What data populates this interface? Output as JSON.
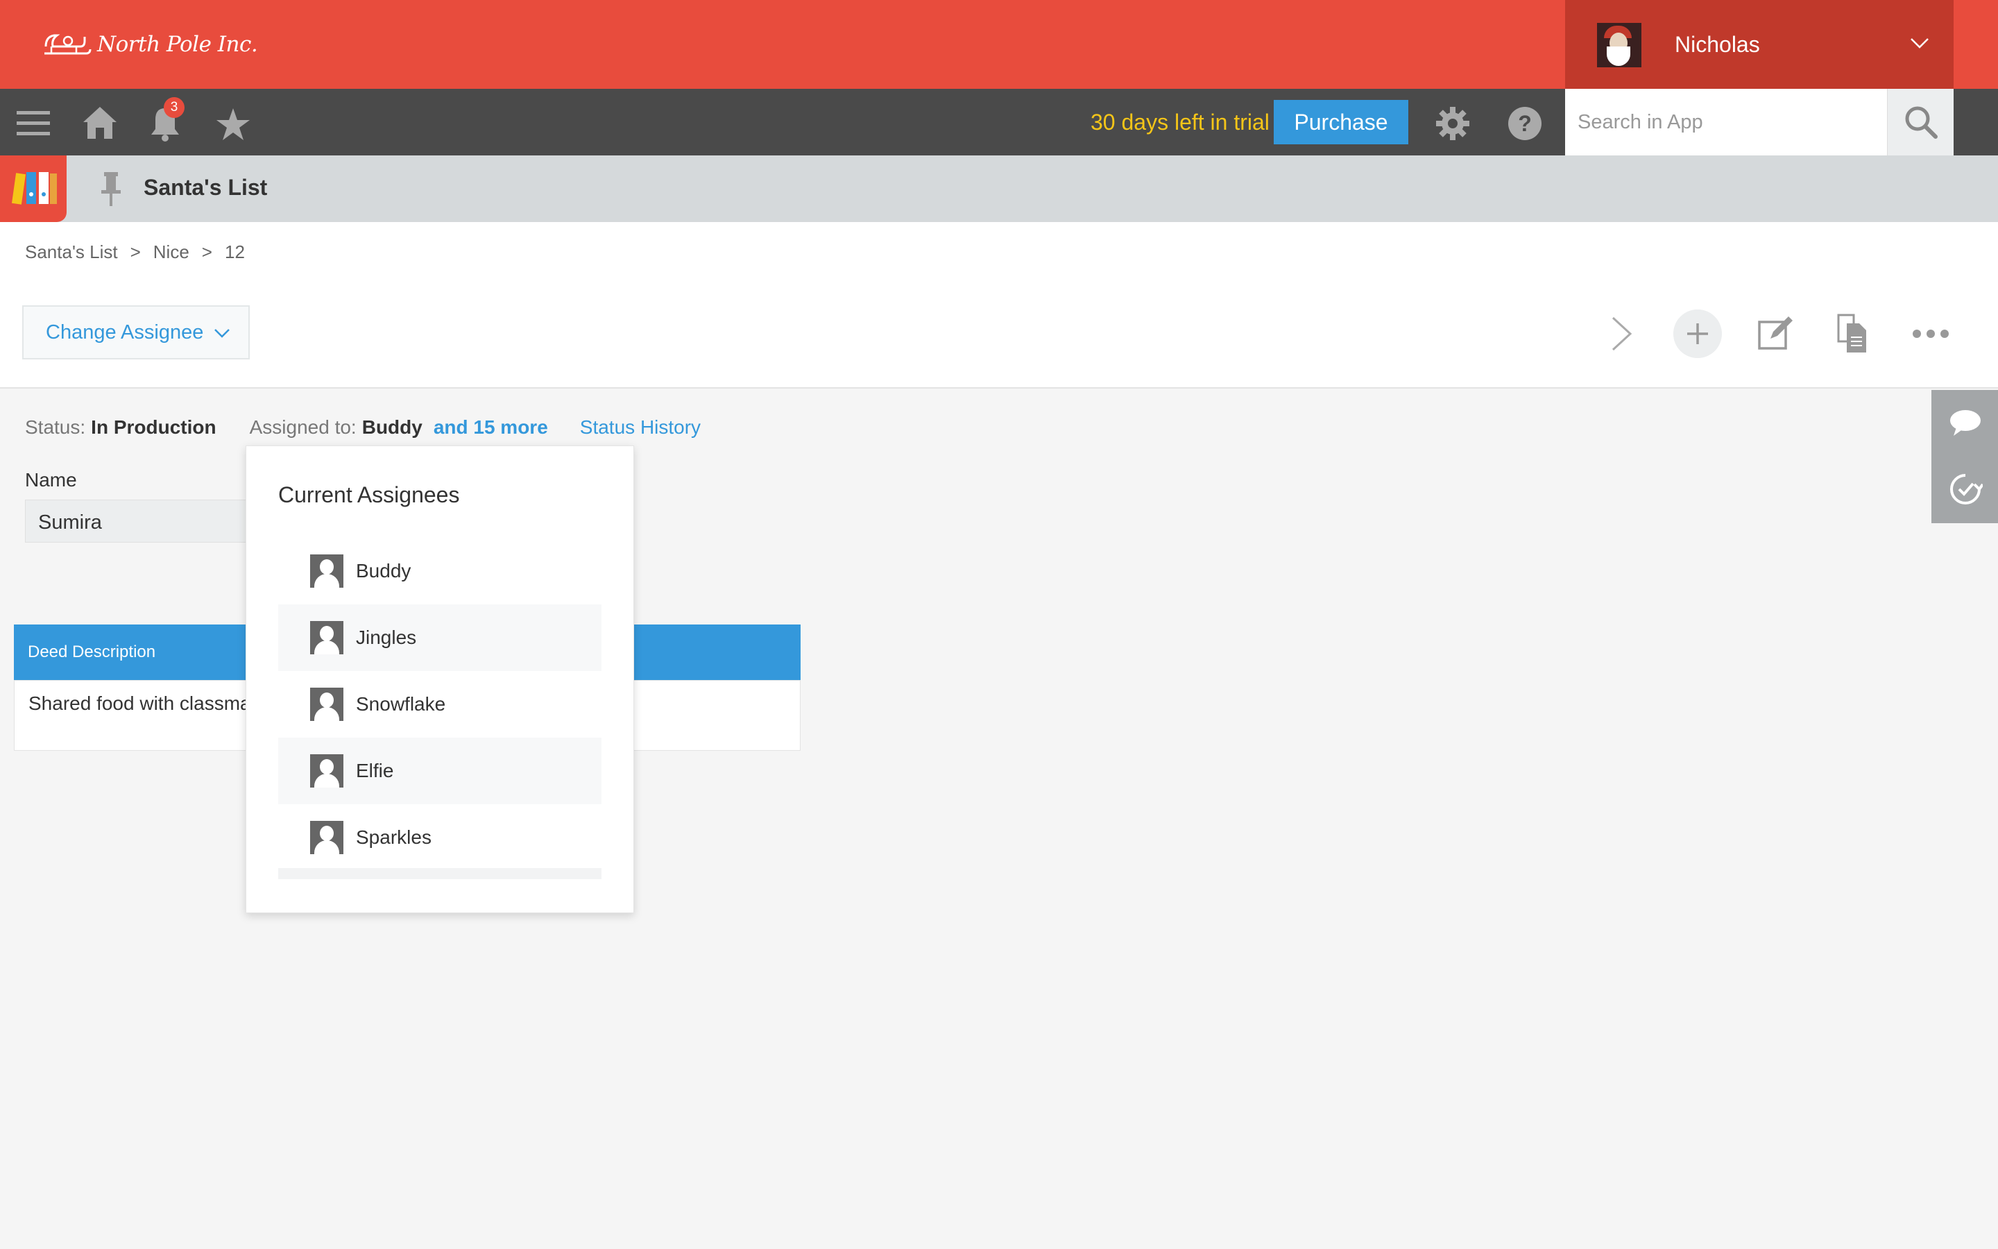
{
  "header": {
    "brand": "North Pole Inc.",
    "user_name": "Nicholas"
  },
  "toolbar": {
    "notification_count": "3",
    "trial_text": "30 days left in trial",
    "purchase_label": "Purchase",
    "search_placeholder": "Search in App"
  },
  "app": {
    "title": "Santa's List"
  },
  "breadcrumb": [
    "Santa's List",
    ">",
    "Nice",
    ">",
    "12"
  ],
  "actions": {
    "change_assignee_label": "Change Assignee"
  },
  "status": {
    "status_label": "Status:",
    "status_value": "In Production",
    "assigned_label": "Assigned to:",
    "assigned_value": "Buddy",
    "more_label": "and 15 more",
    "history_label": "Status History"
  },
  "fields": {
    "name_label": "Name",
    "name_value": "Sumira"
  },
  "table": {
    "header": "Deed Description",
    "cell": "Shared food with classmates at lunch."
  },
  "popup": {
    "title": "Current Assignees",
    "assignees": [
      "Buddy",
      "Jingles",
      "Snowflake",
      "Elfie",
      "Sparkles"
    ]
  },
  "colors": {
    "header_red": "#e84c3d",
    "accent_blue": "#3498db",
    "trial_yellow": "#f5c518",
    "toolbar_gray": "#4a4a4a"
  }
}
